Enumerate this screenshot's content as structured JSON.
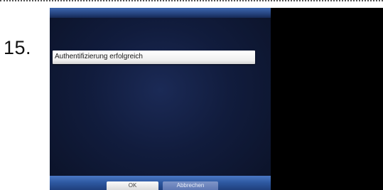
{
  "step": {
    "number": "15."
  },
  "dialog": {
    "message": "Authentifizierung erfolgreich"
  },
  "buttons": {
    "ok_label": "OK",
    "cancel_label": "Abbrechen"
  },
  "colors": {
    "menu_background": "#111c3d",
    "bar_blue": "#2f5aa3",
    "screen_black": "#000000"
  }
}
